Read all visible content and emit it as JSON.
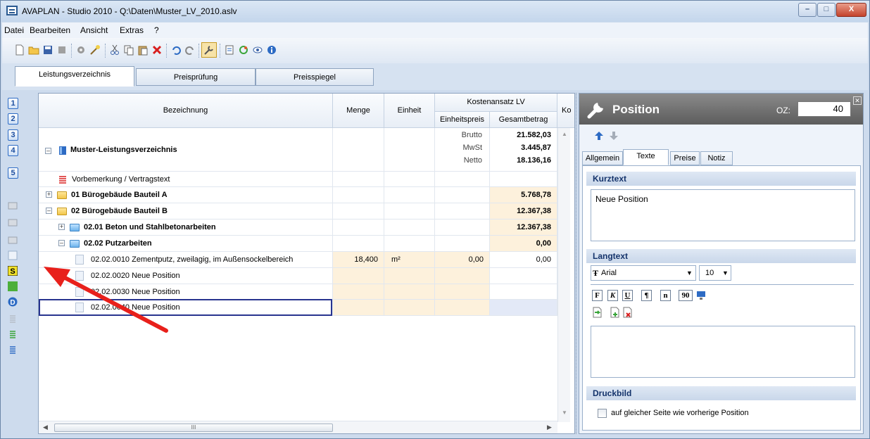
{
  "window": {
    "title": "AVAPLAN - Studio 2010 - Q:\\Daten\\Muster_LV_2010.aslv",
    "minimize": "–",
    "maximize": "□",
    "close": "X"
  },
  "menu": [
    {
      "label": "Datei"
    },
    {
      "label": "Bearbeiten"
    },
    {
      "label": "Ansicht"
    },
    {
      "label": "Extras"
    },
    {
      "label": "?"
    }
  ],
  "tabs": [
    {
      "label": "Leistungsverzeichnis",
      "active": true
    },
    {
      "label": "Preisprüfung"
    },
    {
      "label": "Preisspiegel"
    }
  ],
  "left_numbers": [
    "1",
    "2",
    "3",
    "4",
    "5"
  ],
  "grid": {
    "headers": {
      "bezeichnung": "Bezeichnung",
      "menge": "Menge",
      "einheit": "Einheit",
      "kostenansatz": "Kostenansatz LV",
      "einheitspreis": "Einheitspreis",
      "gesamtbetrag": "Gesamtbetrag",
      "ko": "Ko"
    },
    "root": {
      "label": "Muster-Leistungsverzeichnis",
      "brutto_label": "Brutto",
      "brutto": "21.582,03",
      "mwst_label": "MwSt",
      "mwst": "3.445,87",
      "netto_label": "Netto",
      "netto": "18.136,16"
    },
    "rows": [
      {
        "label": "Vorbemerkung / Vertragstext",
        "bold": false,
        "menge": "",
        "einheit": "",
        "ep": "",
        "gb": ""
      },
      {
        "label": "01  Bürogebäude Bauteil A",
        "bold": true,
        "menge": "",
        "einheit": "",
        "ep": "",
        "gb": "5.768,78"
      },
      {
        "label": "02  Bürogebäude Bauteil B",
        "bold": true,
        "menge": "",
        "einheit": "",
        "ep": "",
        "gb": "12.367,38"
      },
      {
        "label": "02.01  Beton und Stahlbetonarbeiten",
        "bold": true,
        "menge": "",
        "einheit": "",
        "ep": "",
        "gb": "12.367,38"
      },
      {
        "label": "02.02  Putzarbeiten",
        "bold": true,
        "menge": "",
        "einheit": "",
        "ep": "",
        "gb": "0,00"
      },
      {
        "label": "02.02.0010  Zementputz, zweilagig, im Außensockelbereich",
        "bold": false,
        "menge": "18,400",
        "einheit": "m²",
        "ep": "0,00",
        "gb": "0,00"
      },
      {
        "label": "02.02.0020  Neue Position",
        "bold": false,
        "menge": "",
        "einheit": "",
        "ep": "",
        "gb": ""
      },
      {
        "label": "02.02.0030  Neue Position",
        "bold": false,
        "menge": "",
        "einheit": "",
        "ep": "",
        "gb": ""
      },
      {
        "label": "02.02.0040  Neue Position",
        "bold": false,
        "menge": "",
        "einheit": "",
        "ep": "",
        "gb": ""
      }
    ],
    "hscroll_grip": "III"
  },
  "panel": {
    "title": "Position",
    "oz_label": "OZ:",
    "oz_value": "40",
    "tabs": [
      {
        "label": "Allgemein"
      },
      {
        "label": "Texte",
        "active": true
      },
      {
        "label": "Preise"
      },
      {
        "label": "Notiz"
      }
    ],
    "kurztext_header": "Kurztext",
    "kurztext": "Neue Position",
    "langtext_header": "Langtext",
    "font": "Arial",
    "font_size": "10",
    "format_buttons": [
      "F",
      "K",
      "U",
      "¶",
      "n",
      "90"
    ],
    "druckbild_header": "Druckbild",
    "checkbox_label": "auf gleicher Seite wie vorherige Position"
  },
  "colors": {
    "accent": "#2d6bc4",
    "highlight": "#fdf1dc",
    "arrow": "#e8201b"
  }
}
